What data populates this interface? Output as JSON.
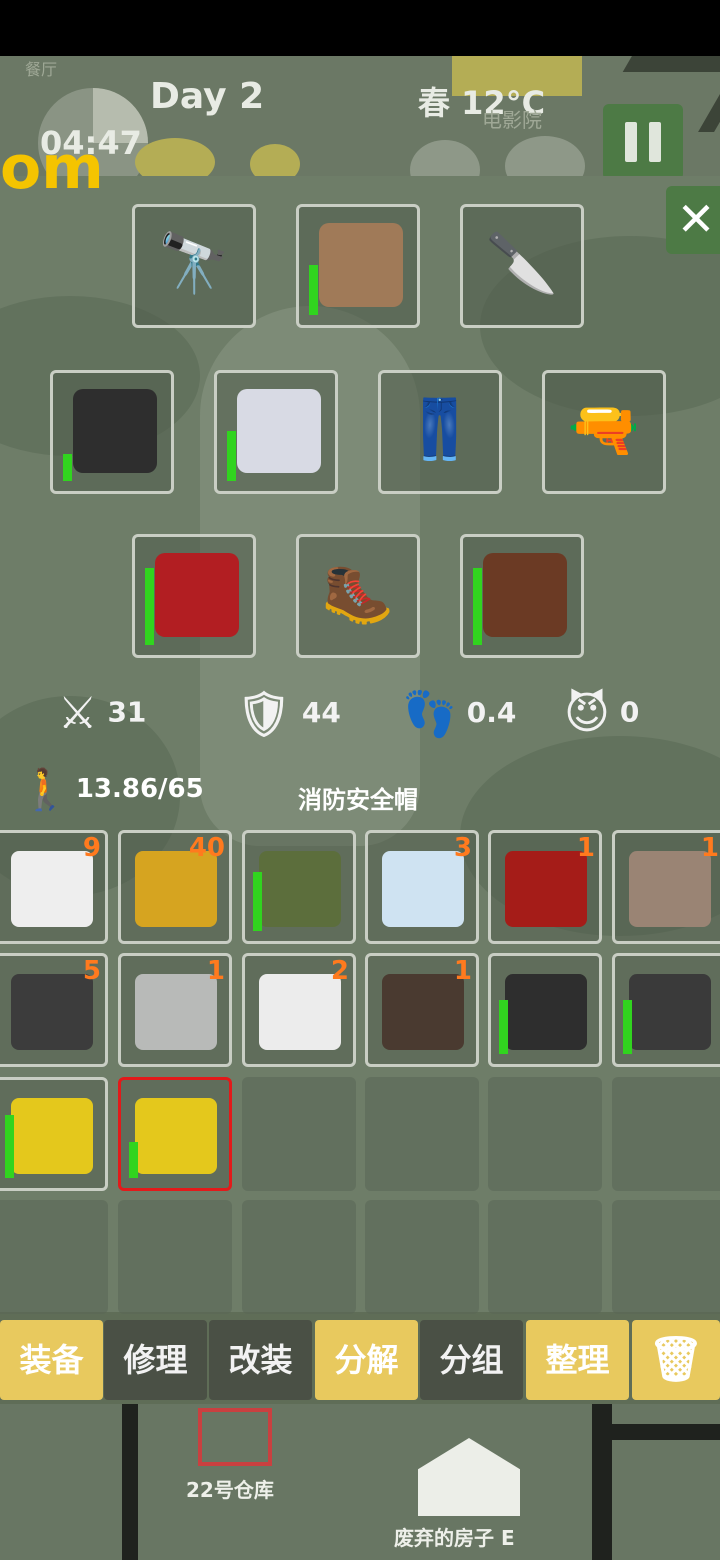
{
  "hud": {
    "day": "Day 2",
    "time": "04:47",
    "season_temp": "春  12°C",
    "location_faded": "电影院",
    "top_faded": "餐厅"
  },
  "overlay_text": "om",
  "close_label": "✕",
  "equipment": [
    {
      "slot": "binoculars",
      "icon": "binoculars-icon",
      "placeholder": "🔭",
      "equipped": false
    },
    {
      "slot": "hat",
      "icon": "boonie-hat-icon",
      "equipped": true,
      "durability": 0.55,
      "color": "#a07a58"
    },
    {
      "slot": "knife",
      "icon": "knife-icon",
      "placeholder": "🔪",
      "equipped": false
    },
    {
      "slot": "body-armor",
      "icon": "body-armor-icon",
      "equipped": true,
      "durability": 0.3,
      "color": "#2e2e2e"
    },
    {
      "slot": "shirt",
      "icon": "tshirt-icon",
      "equipped": true,
      "durability": 0.55,
      "color": "#d8dae4"
    },
    {
      "slot": "pants",
      "icon": "pants-icon",
      "placeholder": "👖",
      "equipped": false
    },
    {
      "slot": "pistol",
      "icon": "pistol-icon",
      "placeholder": "🔫",
      "equipped": false
    },
    {
      "slot": "backpack",
      "icon": "backpack-icon",
      "equipped": true,
      "durability": 0.85,
      "color": "#b21e22"
    },
    {
      "slot": "boots",
      "icon": "boots-icon",
      "placeholder": "🥾",
      "equipped": false
    },
    {
      "slot": "crossbow",
      "icon": "crossbow-icon",
      "equipped": true,
      "durability": 0.85,
      "color": "#6b3a24"
    }
  ],
  "stats": {
    "attack": "31",
    "defense": "44",
    "speed": "0.4",
    "evil": "0"
  },
  "weight": "13.86/65",
  "selected_item_name": "消防安全帽",
  "inventory": [
    {
      "name": "rice-bag",
      "count": "9",
      "color": "#eeeeee"
    },
    {
      "name": "arrow",
      "count": "40",
      "color": "#d6a420"
    },
    {
      "name": "camo-cap",
      "count": "",
      "durability": 0.65,
      "color": "#5c6e3c"
    },
    {
      "name": "water-bottle",
      "count": "3",
      "color": "#cfe3f2"
    },
    {
      "name": "coffee-pack",
      "count": "1",
      "color": "#a51c18"
    },
    {
      "name": "scrap-metal",
      "count": "1",
      "color": "#9a8474"
    },
    {
      "name": "gunpowder",
      "count": "5",
      "color": "#3c3c3c"
    },
    {
      "name": "bolt-nut",
      "count": "1",
      "color": "#b8bab8"
    },
    {
      "name": "empty-bottle",
      "count": "2",
      "color": "#ececec"
    },
    {
      "name": "gun-parts",
      "count": "1",
      "color": "#4a3a30"
    },
    {
      "name": "pistol-glock",
      "count": "",
      "durability": 0.6,
      "color": "#2e2e2e"
    },
    {
      "name": "pistol-silver",
      "count": "",
      "durability": 0.6,
      "color": "#3a3a3a"
    },
    {
      "name": "safety-helmet",
      "count": "",
      "durability": 0.7,
      "color": "#e4c81c"
    },
    {
      "name": "safety-helmet-selected",
      "count": "",
      "durability": 0.4,
      "color": "#e4c81c",
      "selected": true
    }
  ],
  "actions": [
    {
      "label": "装备",
      "style": "gold"
    },
    {
      "label": "修理",
      "style": "dark"
    },
    {
      "label": "改装",
      "style": "dark"
    },
    {
      "label": "分解",
      "style": "gold"
    },
    {
      "label": "分组",
      "style": "dark"
    },
    {
      "label": "整理",
      "style": "gold"
    }
  ],
  "map": {
    "warehouse": "22号仓库",
    "house": "废弃的房子 E"
  }
}
